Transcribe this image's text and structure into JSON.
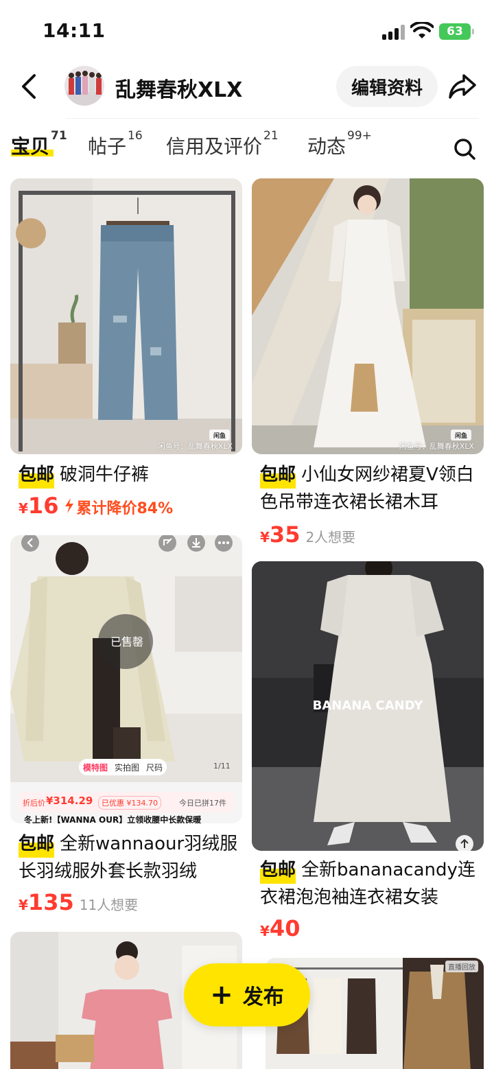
{
  "status": {
    "time": "14:11",
    "battery": "63"
  },
  "header": {
    "shop_name": "乱舞春秋XLX",
    "edit_label": "编辑资料"
  },
  "tabs": [
    {
      "label": "宝贝",
      "count": "71"
    },
    {
      "label": "帖子",
      "count": "16"
    },
    {
      "label": "信用及评价",
      "count": "21"
    },
    {
      "label": "动态",
      "count": "99+"
    }
  ],
  "products": [
    {
      "badge": "包邮",
      "title": "破洞牛仔裤",
      "yen": "¥",
      "price": "16",
      "price_drop": "累计降价84%",
      "watermark": "闲鱼号：乱舞春秋XLX"
    },
    {
      "badge": "包邮",
      "title": "小仙女网纱裙夏V领白色吊带连衣裙长裙木耳",
      "yen": "¥",
      "price": "35",
      "want": "2人想要",
      "watermark": "闲鱼号：乱舞春秋XLX"
    },
    {
      "badge": "包邮",
      "title": "全新wannaour羽绒服长羽绒服外套长款羽绒",
      "yen": "¥",
      "price": "135",
      "want": "11人想要",
      "overlay": {
        "sold": "已售罄",
        "tab_model": "模特图",
        "tab_real": "实拍图",
        "tab_size": "尺码",
        "page": "1/11",
        "discount_label": "折后价",
        "discount_price": "¥314.29",
        "saved": "已优惠 ¥134.70",
        "group": "今日已拼17件",
        "desc": "冬上新!【WANNA OUR】立领收腰中长款保暖"
      }
    },
    {
      "badge": "包邮",
      "title": "全新bananacandy连衣裙泡泡袖连衣裙女装",
      "yen": "¥",
      "price": "40",
      "brand_text": "BANANA CANDY"
    }
  ],
  "extra": {
    "live_tag": "直播回放"
  },
  "publish": {
    "label": "发布"
  }
}
